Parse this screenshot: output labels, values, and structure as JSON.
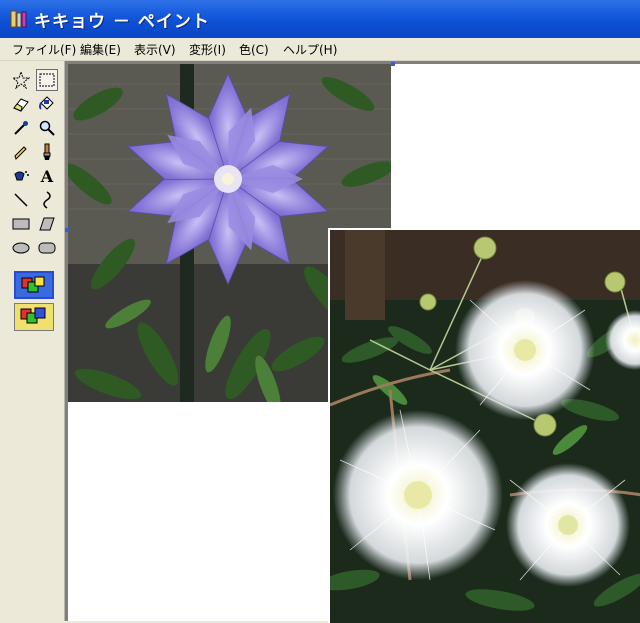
{
  "window": {
    "title": "キキョウ － ペイント"
  },
  "menu": [
    {
      "label": "ファイル(F)"
    },
    {
      "label": "編集(E)"
    },
    {
      "label": "表示(V)"
    },
    {
      "label": "変形(I)"
    },
    {
      "label": "色(C)"
    },
    {
      "label": "ヘルプ(H)"
    }
  ],
  "tools": [
    {
      "name": "free-select",
      "icon": "star-select-icon"
    },
    {
      "name": "rect-select",
      "icon": "rect-select-icon",
      "selected": true
    },
    {
      "name": "eraser",
      "icon": "eraser-icon"
    },
    {
      "name": "fill",
      "icon": "paint-bucket-icon"
    },
    {
      "name": "pick-color",
      "icon": "eyedropper-icon"
    },
    {
      "name": "magnifier",
      "icon": "magnifier-icon"
    },
    {
      "name": "pencil",
      "icon": "pencil-icon"
    },
    {
      "name": "brush",
      "icon": "brush-icon"
    },
    {
      "name": "airbrush",
      "icon": "airbrush-icon"
    },
    {
      "name": "text",
      "icon": "text-icon",
      "glyph": "A"
    },
    {
      "name": "line",
      "icon": "line-icon"
    },
    {
      "name": "curve",
      "icon": "curve-icon"
    },
    {
      "name": "rectangle",
      "icon": "rectangle-icon"
    },
    {
      "name": "polygon",
      "icon": "polygon-icon"
    },
    {
      "name": "ellipse",
      "icon": "ellipse-icon"
    },
    {
      "name": "rounded-rect",
      "icon": "rounded-rect-icon"
    }
  ],
  "images": {
    "first": "bellflower-photo",
    "second": "mimosa-photo"
  },
  "colors": {
    "titlebar": "#0a46c4",
    "bellflower": "#8a78d8",
    "foliage": "#2e4a22"
  }
}
